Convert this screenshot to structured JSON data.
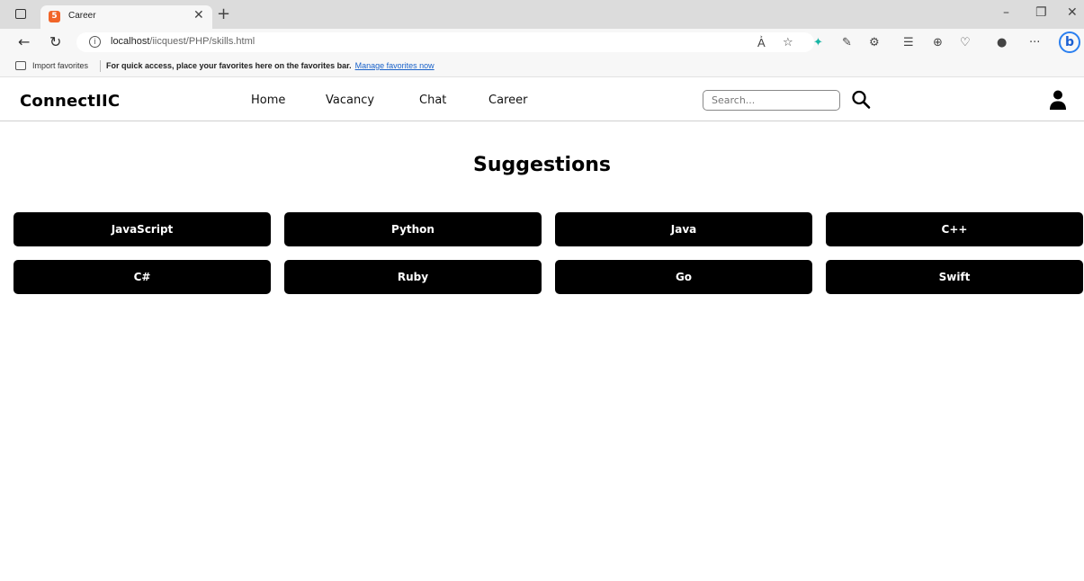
{
  "browser": {
    "tab_title": "Career",
    "url_host": "localhost",
    "url_path": "/iicquest/PHP/skills.html",
    "favorites": {
      "import_label": "Import favorites",
      "message": "For quick access, place your favorites here on the favorites bar.",
      "manage_link": "Manage favorites now"
    }
  },
  "site": {
    "brand": "ConnectIIC",
    "nav": {
      "home": "Home",
      "vacancy": "Vacancy",
      "chat": "Chat",
      "career": "Career"
    },
    "search_placeholder": "Search..."
  },
  "main": {
    "heading": "Suggestions",
    "skills": [
      "JavaScript",
      "Python",
      "Java",
      "C++",
      "C#",
      "Ruby",
      "Go",
      "Swift"
    ]
  }
}
